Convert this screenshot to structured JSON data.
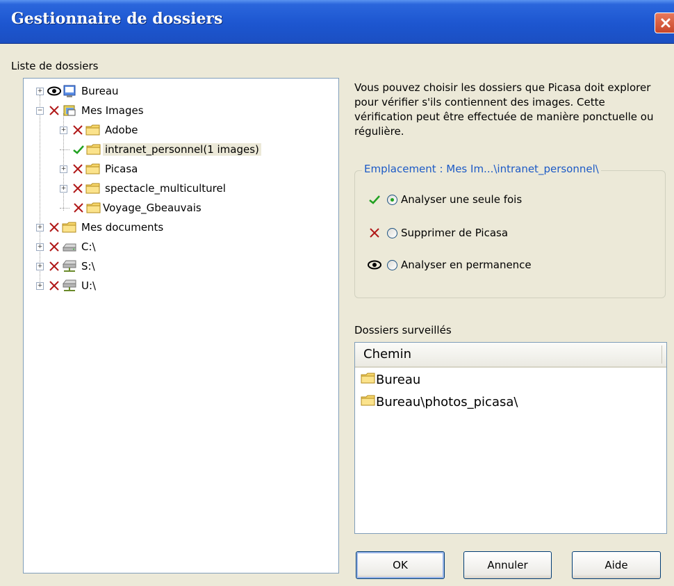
{
  "window": {
    "title": "Gestionnaire de dossiers"
  },
  "tree": {
    "label": "Liste de dossiers",
    "items": [
      {
        "label": "Bureau",
        "status": "watch",
        "icon": "desktop-icon"
      },
      {
        "label": "Mes Images",
        "status": "remove",
        "icon": "pictures-icon"
      },
      {
        "label": "Adobe",
        "status": "remove",
        "icon": "folder-icon"
      },
      {
        "label": "intranet_personnel(1 images)",
        "status": "scan-once",
        "icon": "folder-icon",
        "selected": true
      },
      {
        "label": "Picasa",
        "status": "remove",
        "icon": "folder-icon"
      },
      {
        "label": "spectacle_multiculturel",
        "status": "remove",
        "icon": "folder-icon"
      },
      {
        "label": "Voyage_Gbeauvais",
        "status": "remove",
        "icon": "folder-icon"
      },
      {
        "label": "Mes documents",
        "status": "remove",
        "icon": "folder-icon"
      },
      {
        "label": "C:\\",
        "status": "remove",
        "icon": "drive-icon"
      },
      {
        "label": "S:\\",
        "status": "remove",
        "icon": "network-drive-icon"
      },
      {
        "label": "U:\\",
        "status": "remove",
        "icon": "network-drive-icon"
      }
    ]
  },
  "description": "Vous pouvez choisir les dossiers que Picasa doit explorer pour vérifier s'ils contiennent des images. Cette vérification peut être effectuée de manière ponctuelle ou régulière.",
  "location": {
    "legend": "Emplacement : Mes Im...\\intranet_personnel\\",
    "options": [
      {
        "label": "Analyser une seule fois",
        "checked": true
      },
      {
        "label": "Supprimer de Picasa",
        "checked": false
      },
      {
        "label": "Analyser en permanence",
        "checked": false
      }
    ]
  },
  "watched": {
    "label": "Dossiers surveillés",
    "column": "Chemin",
    "rows": [
      "Bureau",
      "Bureau\\photos_picasa\\"
    ]
  },
  "buttons": {
    "ok": "OK",
    "cancel": "Annuler",
    "help": "Aide"
  },
  "colors": {
    "titlebar": "#2a66dc",
    "dialog_bg": "#ece9d8",
    "check": "#21a121",
    "cross": "#b01818",
    "legend_text": "#1c5ac6"
  }
}
